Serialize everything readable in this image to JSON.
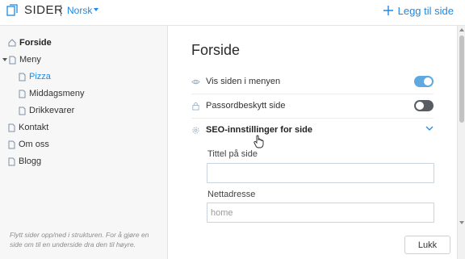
{
  "header": {
    "app_title": "SIDER",
    "language": "Norsk",
    "add_page_label": "Legg til side"
  },
  "sidebar": {
    "items": [
      {
        "label": "Forside",
        "active": true,
        "level": 0
      },
      {
        "label": "Meny",
        "expanded": true,
        "level": 0
      },
      {
        "label": "Pizza",
        "level": 1
      },
      {
        "label": "Middagsmeny",
        "level": 1
      },
      {
        "label": "Drikkevarer",
        "level": 1
      },
      {
        "label": "Kontakt",
        "level": 0
      },
      {
        "label": "Om oss",
        "level": 0
      },
      {
        "label": "Blogg",
        "level": 0
      }
    ],
    "hint": "Flytt sider opp/ned i strukturen. For å gjøre en side om til en underside dra den til høyre."
  },
  "main": {
    "page_title": "Forside",
    "options": {
      "show_in_menu": {
        "label": "Vis siden i menyen",
        "enabled": true
      },
      "password_protected": {
        "label": "Passordbeskytt side",
        "enabled": false
      }
    },
    "seo": {
      "label": "SEO-innstillinger for side",
      "expanded": true,
      "page_title_field": {
        "label": "Tittel på side",
        "value": "",
        "placeholder": ""
      },
      "url_field": {
        "label": "Nettadresse",
        "value": "",
        "placeholder": "home"
      }
    },
    "close_label": "Lukk"
  },
  "colors": {
    "accent": "#1e88e5",
    "toggle_on": "#5fa8e0",
    "toggle_off": "#585d63",
    "sidebar_bg": "#f7f7f7"
  },
  "icons": {
    "logo": "pages-icon",
    "add": "plus-icon",
    "home": "home-icon",
    "page": "document-icon",
    "visibility": "eye-icon",
    "lock": "lock-icon",
    "seo": "gear-icon",
    "expand": "chevron-down-icon",
    "pointer": "hand-cursor-icon"
  }
}
